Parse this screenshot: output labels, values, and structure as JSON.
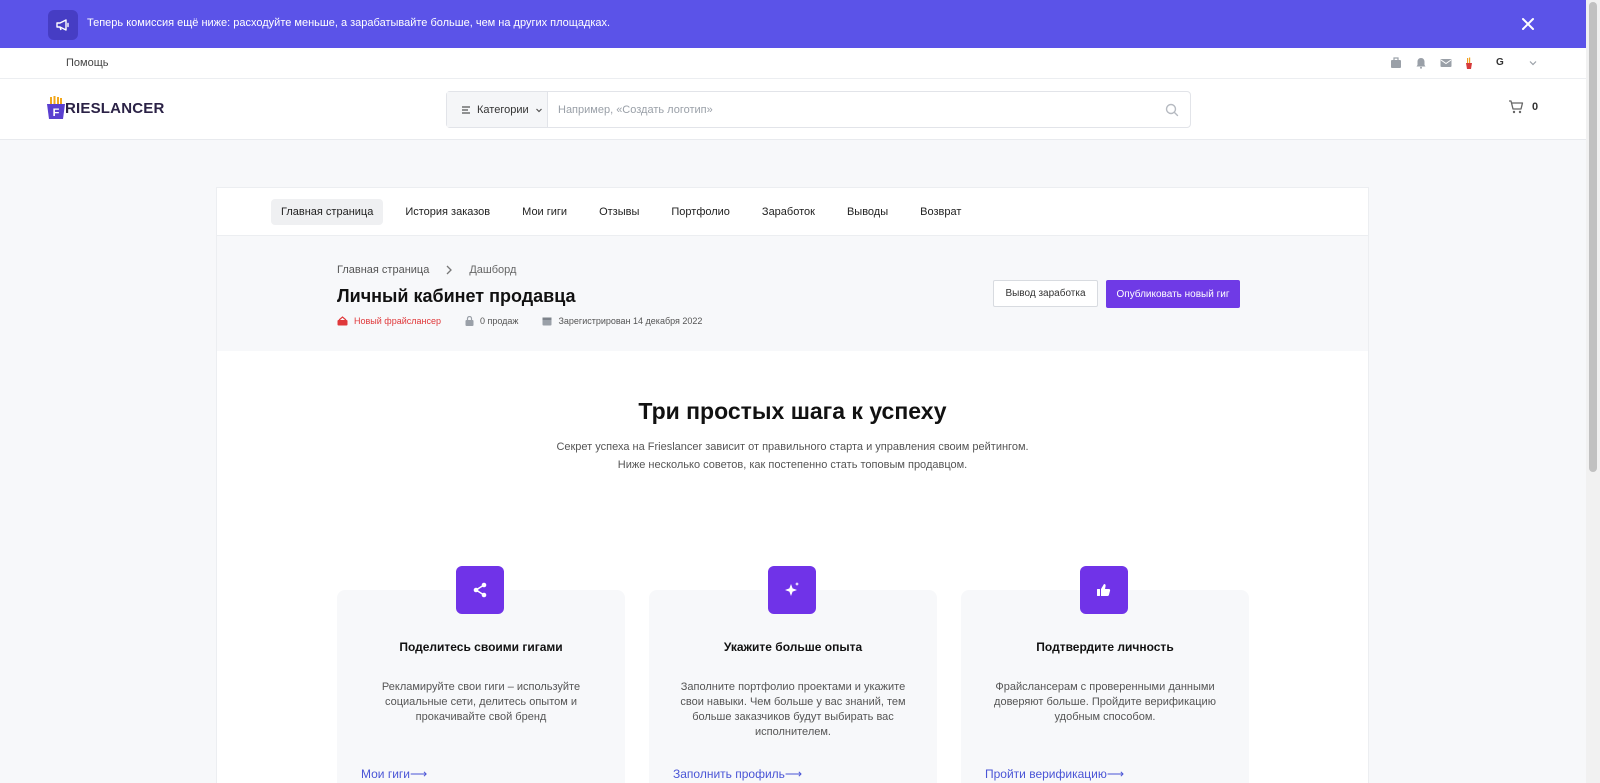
{
  "announcement": {
    "text": "Теперь комиссия ещё ниже: расходуйте меньше, а зарабатывайте больше, чем на других площадках.",
    "color": "#5b53e8"
  },
  "utilbar": {
    "help": "Помощь",
    "avatar_letter": "G"
  },
  "header": {
    "logo_prefix": "F",
    "logo_text": "RIESLANCER",
    "categories_label": "Категории",
    "search_placeholder": "Например, «Создать логотип»",
    "cart_count": "0"
  },
  "tabs": [
    {
      "label": "Главная страница",
      "active": true
    },
    {
      "label": "История заказов"
    },
    {
      "label": "Мои гиги"
    },
    {
      "label": "Отзывы"
    },
    {
      "label": "Портфолио"
    },
    {
      "label": "Заработок"
    },
    {
      "label": "Выводы"
    },
    {
      "label": "Возврат"
    }
  ],
  "dashboard": {
    "breadcrumb_home": "Главная страница",
    "breadcrumb_current": "Дашборд",
    "title": "Личный кабинет продавца",
    "level": "Новый фрайслансер",
    "sales": "0 продаж",
    "registered": "Зарегистрирован 14 декабря 2022",
    "withdraw_button": "Вывод заработка",
    "publish_button": "Опубликовать новый гиг",
    "accent": "#6f3ae6"
  },
  "steps": {
    "title": "Три простых шага к успеху",
    "subtitle_line1": "Секрет успеха на Frieslancer зависит от правильного старта и управления своим рейтингом.",
    "subtitle_line2": "Ниже несколько советов, как постепенно стать топовым продавцом.",
    "items": [
      {
        "icon": "share-icon",
        "title": "Поделитесь своими гигами",
        "desc": "Рекламируйте свои гиги – используйте социальные сети, делитесь опытом и прокачивайте свой бренд",
        "link": "Мои гиги⟶"
      },
      {
        "icon": "sparkle-icon",
        "title": "Укажите больше опыта",
        "desc": "Заполните портфолио проектами и укажите свои навыки. Чем больше у вас знаний, тем больше заказчиков будут выбирать вас исполнителем.",
        "link": "Заполнить профиль⟶"
      },
      {
        "icon": "thumbs-up-icon",
        "title": "Подтвердите личность",
        "desc": "Фрайслансерам с проверенными данными доверяют больше. Пройдите верификацию удобным способом.",
        "link": "Пройти верификацию⟶"
      }
    ]
  }
}
